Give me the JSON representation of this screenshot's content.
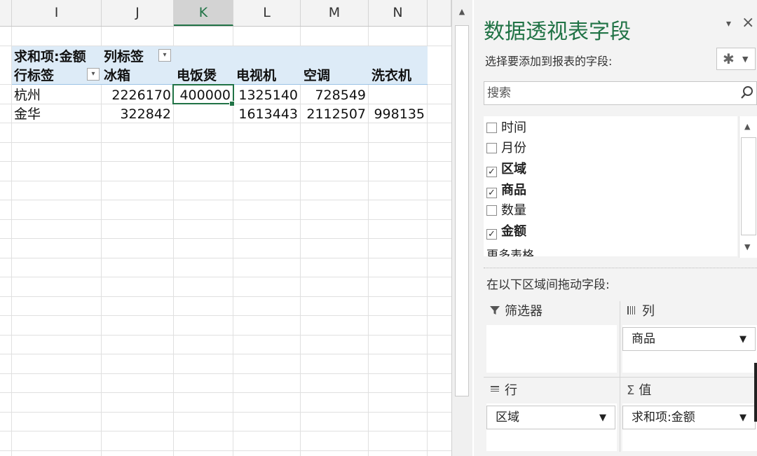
{
  "sheet": {
    "columns": [
      "I",
      "J",
      "K",
      "L",
      "M",
      "N"
    ],
    "selected_column": "K",
    "pivot": {
      "summary_label": "求和项:金额",
      "column_labels_label": "列标签",
      "row_labels_label": "行标签",
      "column_items": [
        "冰箱",
        "电饭煲",
        "电视机",
        "空调",
        "洗衣机"
      ],
      "rows": [
        {
          "label": "杭州",
          "values": [
            "2226170",
            "400000",
            "1325140",
            "728549",
            ""
          ]
        },
        {
          "label": "金华",
          "values": [
            "322842",
            "",
            "1613443",
            "2112507",
            "998135"
          ]
        }
      ]
    }
  },
  "pane": {
    "title": "数据透视表字段",
    "close_dropdown_glyph": "▾",
    "close_glyph": "×",
    "subtitle": "选择要添加到报表的字段:",
    "gear_glyph": "✱",
    "gear_dropdown_glyph": "▼",
    "search_placeholder": "搜索",
    "fields": [
      {
        "name": "时间",
        "checked": false
      },
      {
        "name": "月份",
        "checked": false
      },
      {
        "name": "区域",
        "checked": true
      },
      {
        "name": "商品",
        "checked": true
      },
      {
        "name": "数量",
        "checked": false
      },
      {
        "name": "金额",
        "checked": true
      }
    ],
    "more_tables": "更多表格...",
    "drag_label": "在以下区域间拖动字段:",
    "areas": {
      "filters": {
        "title": "筛选器",
        "icon": "filter-icon",
        "items": []
      },
      "columns": {
        "title": "列",
        "icon": "columns-icon",
        "items": [
          "商品"
        ]
      },
      "rows": {
        "title": "行",
        "icon": "rows-icon",
        "items": [
          "区域"
        ]
      },
      "values": {
        "title": "值",
        "icon": "sigma-icon",
        "items": [
          "求和项:金额"
        ]
      }
    }
  }
}
